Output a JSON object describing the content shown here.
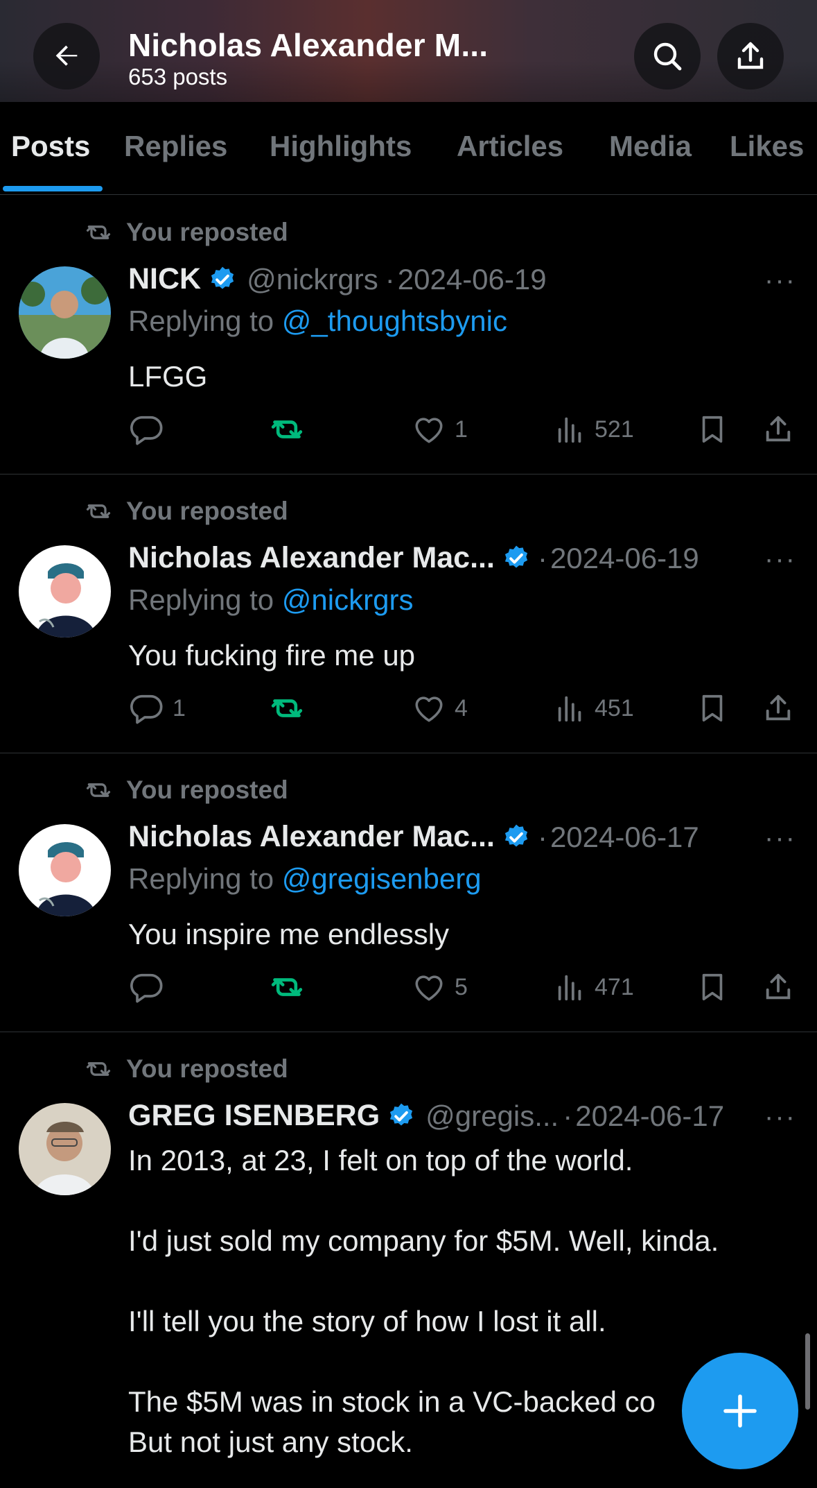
{
  "header": {
    "title": "Nicholas Alexander M...",
    "post_count": "653 posts",
    "back_icon": "arrow-left-icon",
    "search_icon": "search-icon",
    "share_icon": "share-icon"
  },
  "tabs": [
    {
      "label": "Posts",
      "active": true
    },
    {
      "label": "Replies",
      "active": false
    },
    {
      "label": "Highlights",
      "active": false
    },
    {
      "label": "Articles",
      "active": false
    },
    {
      "label": "Media",
      "active": false
    },
    {
      "label": "Likes",
      "active": false
    }
  ],
  "posts": [
    {
      "repost_label": "You reposted",
      "name": "NICK",
      "handle": "@nickrgrs",
      "dot": "·",
      "date": "2024-06-19",
      "more": "···",
      "replying_prefix": "Replying to ",
      "replying_to": "@_thoughtsbynic",
      "text": "LFGG",
      "replies": "",
      "likes": "1",
      "views": "521"
    },
    {
      "repost_label": "You reposted",
      "name": "Nicholas Alexander Mac...",
      "handle": "",
      "dot": "·",
      "date": "2024-06-19",
      "more": "···",
      "replying_prefix": "Replying to ",
      "replying_to": "@nickrgrs",
      "text": "You fucking fire me up",
      "replies": "1",
      "likes": "4",
      "views": "451"
    },
    {
      "repost_label": "You reposted",
      "name": "Nicholas Alexander Mac...",
      "handle": "",
      "dot": "·",
      "date": "2024-06-17",
      "more": "···",
      "replying_prefix": "Replying to ",
      "replying_to": "@gregisenberg",
      "text": "You inspire me endlessly",
      "replies": "",
      "likes": "5",
      "views": "471"
    },
    {
      "repost_label": "You reposted",
      "name": "GREG ISENBERG",
      "handle": "@gregis...",
      "dot": "·",
      "date": "2024-06-17",
      "more": "···",
      "text": "In 2013, at 23, I felt on top of the world.\n\nI'd just sold my company for $5M. Well, kinda.\n\nI'll tell you the story of how I lost it all.\n\nThe $5M was in stock in a VC-backed co\nBut not just any stock."
    }
  ],
  "colors": {
    "accent": "#1d9bf0",
    "repost_green": "#00ba7c",
    "muted": "#71767b",
    "text": "#e7e9ea"
  },
  "fab": {
    "icon": "plus-icon"
  }
}
